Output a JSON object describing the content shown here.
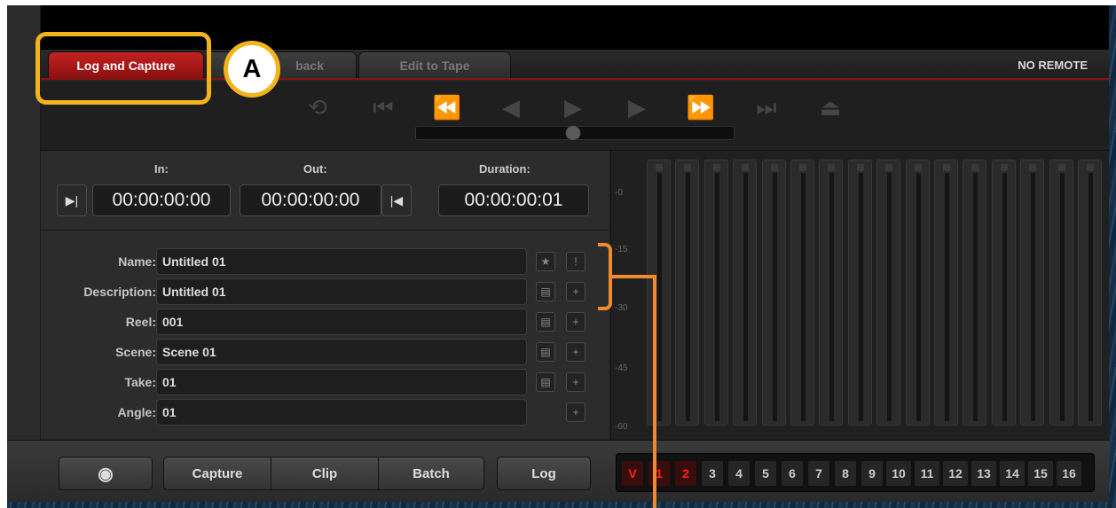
{
  "tabs": {
    "active": "Log and Capture",
    "hidden_partial": "back",
    "edit_to_tape": "Edit to Tape",
    "remote_status": "NO REMOTE"
  },
  "annotation": {
    "marker": "A"
  },
  "transport": {
    "buttons": [
      "loop-icon",
      "go-to-start-icon",
      "rewind-icon",
      "step-back-icon",
      "play-icon",
      "step-forward-icon",
      "fast-forward-icon",
      "go-to-end-icon",
      "eject-icon"
    ]
  },
  "timecode": {
    "in_label": "In:",
    "in_value": "00:00:00:00",
    "out_label": "Out:",
    "out_value": "00:00:00:00",
    "duration_label": "Duration:",
    "duration_value": "00:00:00:01"
  },
  "fields": [
    {
      "label": "Name:",
      "value": "Untitled 01"
    },
    {
      "label": "Description:",
      "value": "Untitled 01"
    },
    {
      "label": "Reel:",
      "value": "001"
    },
    {
      "label": "Scene:",
      "value": "Scene 01"
    },
    {
      "label": "Take:",
      "value": "01"
    },
    {
      "label": "Angle:",
      "value": "01"
    }
  ],
  "meters": {
    "scale": [
      "-0",
      "-15",
      "-30",
      "-45",
      "-60"
    ],
    "channel_count": 16
  },
  "bottom": {
    "capture": "Capture",
    "clip": "Clip",
    "batch": "Batch",
    "log": "Log",
    "channels": [
      "V",
      "1",
      "2",
      "3",
      "4",
      "5",
      "6",
      "7",
      "8",
      "9",
      "10",
      "11",
      "12",
      "13",
      "14",
      "15",
      "16"
    ]
  },
  "colors": {
    "accent_red": "#c32222",
    "annotation_yellow": "#f2b41a",
    "annotation_orange": "#f08a2c"
  }
}
